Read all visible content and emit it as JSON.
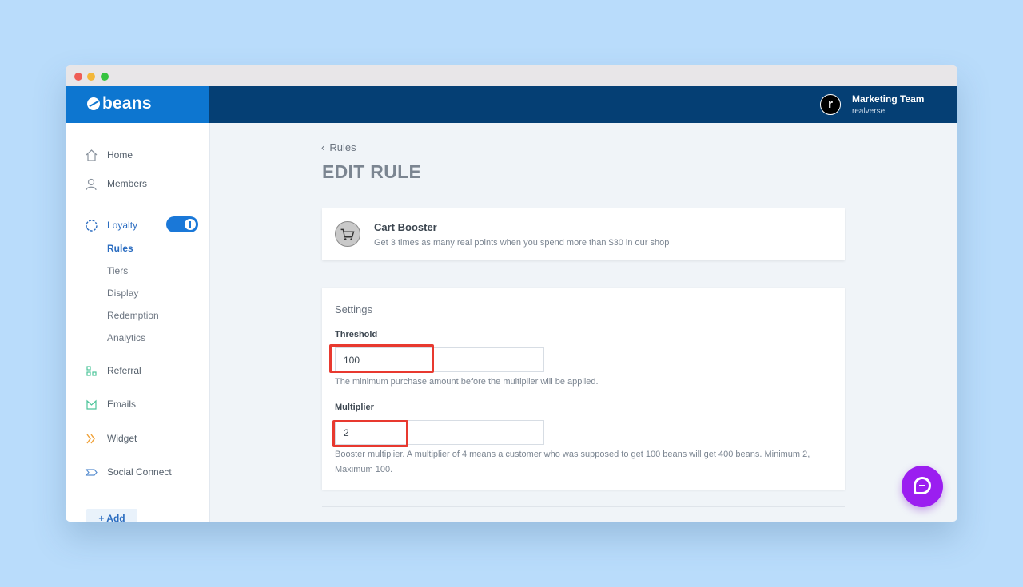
{
  "app": {
    "brand": "beans"
  },
  "account": {
    "avatar_letter": "r",
    "team": "Marketing Team",
    "shop": "realverse"
  },
  "sidebar": {
    "items": [
      {
        "label": "Home",
        "icon": "home-icon"
      },
      {
        "label": "Members",
        "icon": "members-icon"
      },
      {
        "label": "Loyalty",
        "icon": "loyalty-icon",
        "toggle": "on"
      },
      {
        "label": "Referral",
        "icon": "referral-icon"
      },
      {
        "label": "Emails",
        "icon": "emails-icon"
      },
      {
        "label": "Widget",
        "icon": "widget-icon"
      },
      {
        "label": "Social Connect",
        "icon": "social-connect-icon"
      }
    ],
    "loyalty_subitems": [
      "Rules",
      "Tiers",
      "Display",
      "Redemption",
      "Analytics"
    ],
    "active_subitem": "Rules",
    "add_label": "+ Add"
  },
  "breadcrumb": {
    "label": "Rules"
  },
  "page": {
    "title": "EDIT RULE"
  },
  "rule": {
    "title": "Cart Booster",
    "description": "Get 3 times as many real points when you spend more than $30 in our shop",
    "icon": "cart-icon"
  },
  "settings": {
    "heading": "Settings",
    "threshold": {
      "label": "Threshold",
      "value": "100",
      "help": "The minimum purchase amount before the multiplier will be applied."
    },
    "multiplier": {
      "label": "Multiplier",
      "value": "2",
      "help": "Booster multiplier. A multiplier of 4 means a customer who was supposed to get 100 beans will get 400 beans. Minimum 2, Maximum 100."
    }
  },
  "colors": {
    "brand_blue": "#0d76d0",
    "topbar_navy": "#053f74",
    "highlight_red": "#e8392f",
    "chat_purple": "#9b1ef0",
    "background": "#b9dcfb"
  }
}
